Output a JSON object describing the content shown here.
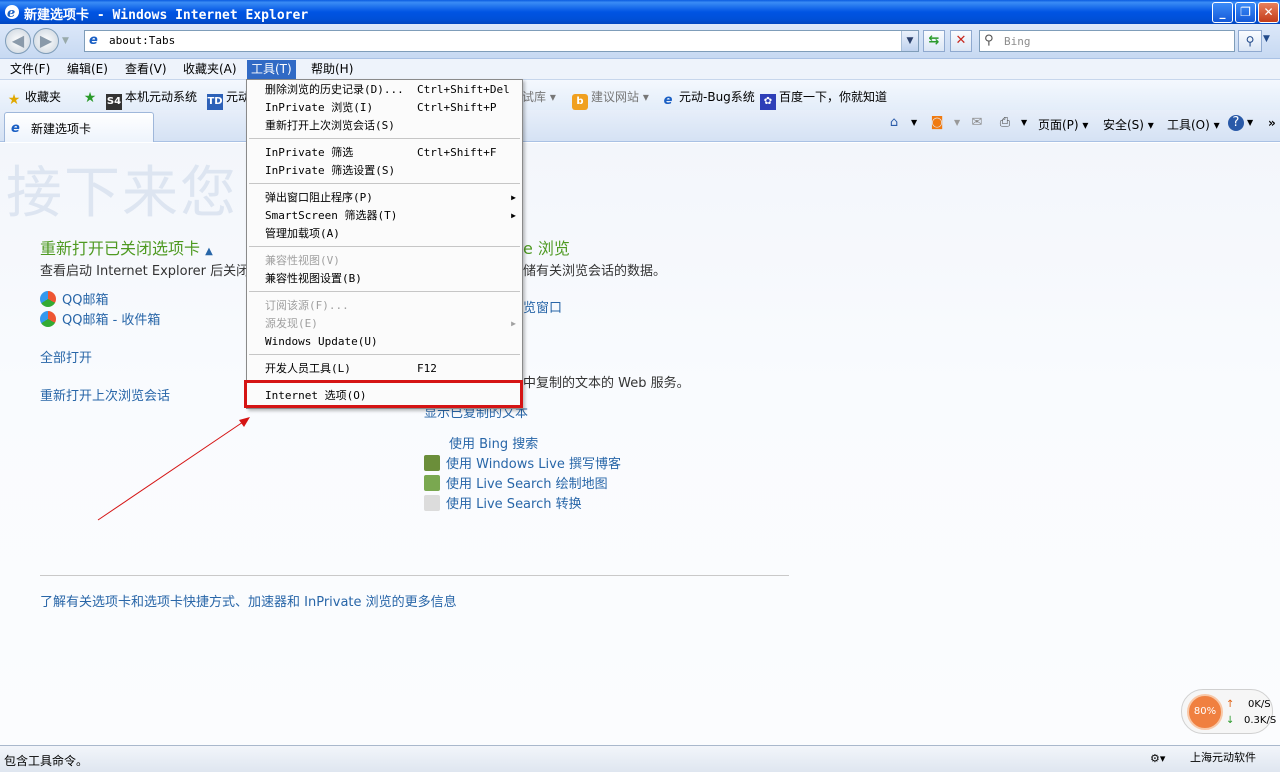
{
  "window": {
    "title": "新建选项卡 - Windows Internet Explorer",
    "buttons": {
      "minimize": "_",
      "maximize": "❐",
      "close": "✕"
    }
  },
  "address": {
    "url": "about:Tabs",
    "search_placeholder": "Bing"
  },
  "menubar": [
    "文件(F)",
    "编辑(E)",
    "查看(V)",
    "收藏夹(A)",
    "工具(T)",
    "帮助(H)"
  ],
  "favorites": {
    "label": "收藏夹",
    "items": [
      "本机元动系统",
      "元动",
      "试库",
      "建议网站",
      "元动-Bug系统",
      "百度一下，你就知道"
    ]
  },
  "tab": {
    "label": "新建选项卡"
  },
  "commandbar": {
    "page": "页面(P)",
    "safety": "安全(S)",
    "tools": "工具(O)"
  },
  "tools_menu": {
    "items": [
      {
        "label": "删除浏览的历史记录(D)...",
        "shortcut": "Ctrl+Shift+Del"
      },
      {
        "label": "InPrivate 浏览(I)",
        "shortcut": "Ctrl+Shift+P"
      },
      {
        "label": "重新打开上次浏览会话(S)",
        "shortcut": ""
      },
      {
        "label": "InPrivate 筛选",
        "shortcut": "Ctrl+Shift+F"
      },
      {
        "label": "InPrivate 筛选设置(S)",
        "shortcut": ""
      },
      {
        "label": "弹出窗口阻止程序(P)",
        "shortcut": ""
      },
      {
        "label": "SmartScreen 筛选器(T)",
        "shortcut": ""
      },
      {
        "label": "管理加载项(A)",
        "shortcut": ""
      },
      {
        "label": "兼容性视图(V)",
        "shortcut": ""
      },
      {
        "label": "兼容性视图设置(B)",
        "shortcut": ""
      },
      {
        "label": "订阅该源(F)...",
        "shortcut": ""
      },
      {
        "label": "源发现(E)",
        "shortcut": ""
      },
      {
        "label": "Windows Update(U)",
        "shortcut": ""
      },
      {
        "label": "开发人员工具(L)",
        "shortcut": "F12"
      },
      {
        "label": "Internet 选项(O)",
        "shortcut": ""
      }
    ]
  },
  "content": {
    "watermark": "接下来您",
    "left": {
      "title": "重新打开已关闭选项卡",
      "desc": "查看启动 Internet Explorer 后关闭的",
      "links": [
        "QQ邮箱",
        "QQ邮箱 - 收件箱"
      ],
      "open_all": "全部打开",
      "reopen_session": "重新打开上次浏览会话"
    },
    "right": {
      "title_partial": "e 浏览",
      "desc": "储有关浏览会话的数据。",
      "link_partial": "览窗口",
      "accel_desc": "中复制的文本的 Web 服务。",
      "show_copied": "显示已复制的文本",
      "services": [
        "使用 Bing 搜索",
        "使用 Windows Live 撰写博客",
        "使用 Live Search 绘制地图",
        "使用 Live Search 转换"
      ]
    },
    "footer_link": "了解有关选项卡和选项卡快捷方式、加速器和 InPrivate 浏览的更多信息"
  },
  "status": {
    "text": "包含工具命令。",
    "right": "上海元动软件"
  },
  "speed": {
    "percent": "80%",
    "up": "0K/S",
    "down": "0.3K/S"
  },
  "colors": {
    "accent": "#316ac5",
    "highlight": "#d51414",
    "section_green": "#4f9a22",
    "link_blue": "#2866a8"
  }
}
